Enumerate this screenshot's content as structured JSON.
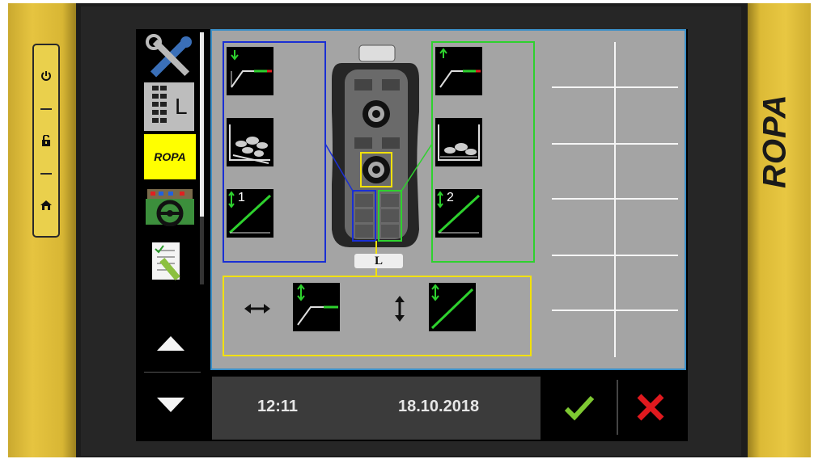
{
  "brand": {
    "name": "ROPA",
    "tab_logo": "ROPA"
  },
  "hardware_buttons": [
    {
      "name": "power-icon",
      "glyph": "⏻"
    },
    {
      "name": "unlock-icon",
      "glyph": "🔓"
    },
    {
      "name": "home-icon",
      "glyph": "⌂"
    }
  ],
  "sidebar": {
    "items": [
      {
        "name": "tools-icon"
      },
      {
        "name": "joystick-layout-icon",
        "label": "L"
      },
      {
        "name": "ropa-logo-tab",
        "label": "ROPA"
      },
      {
        "name": "steering-wheel-icon"
      },
      {
        "name": "checklist-icon"
      }
    ],
    "scroll_up": "up-arrow-icon",
    "scroll_down": "down-arrow-icon"
  },
  "joystick": {
    "label": "L"
  },
  "left_group": {
    "numbers": [
      "1"
    ],
    "color": "#1a2fd4"
  },
  "right_group": {
    "numbers": [
      "2"
    ],
    "color": "#2ed12e"
  },
  "bottom_group": {
    "color": "#f2e10a"
  },
  "status": {
    "time": "12:11",
    "date": "18.10.2018"
  },
  "actions": {
    "confirm_icon": "check-icon",
    "cancel_icon": "cancel-icon"
  },
  "colors": {
    "accent_yellow": "#e6c440",
    "screen_gray": "#a4a4a4",
    "confirm_green": "#7ec832",
    "cancel_red": "#e0191e"
  }
}
